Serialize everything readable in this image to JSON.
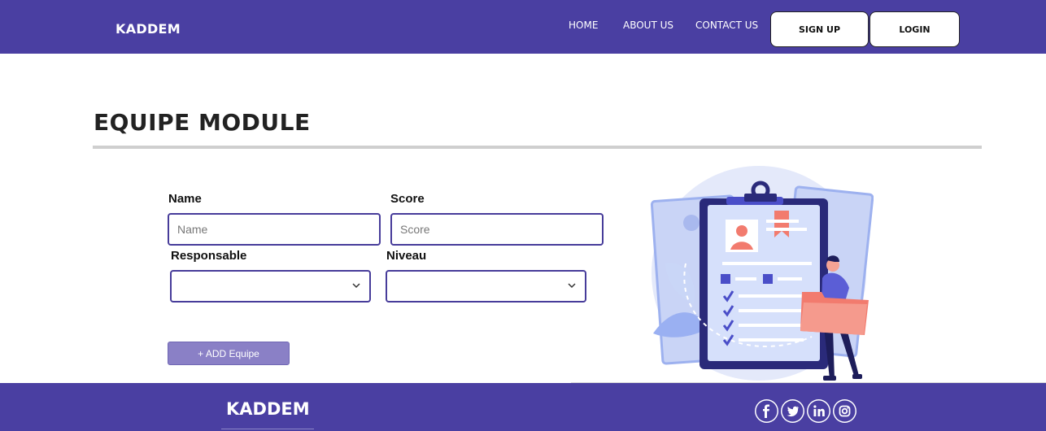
{
  "nav": {
    "brand": "KADDEM",
    "links": [
      "HOME",
      "ABOUT US",
      "CONTACT US"
    ],
    "signup_label": "SIGN UP",
    "login_label": "LOGIN"
  },
  "page": {
    "title": "EQUIPE MODULE"
  },
  "form": {
    "name_label": "Name",
    "name_placeholder": "Name",
    "score_label": "Score",
    "score_placeholder": "Score",
    "responsable_label": "Responsable",
    "responsable_value": "",
    "niveau_label": "Niveau",
    "niveau_value": "",
    "add_button_label": "+ ADD Equipe"
  },
  "footer": {
    "brand": "KADDEM",
    "social_icons": [
      "facebook-icon",
      "twitter-icon",
      "linkedin-icon",
      "instagram-icon"
    ]
  },
  "colors": {
    "primary": "#4a3fa2",
    "button_muted": "#8a80c6",
    "illustration_accent": "#f27b6e"
  }
}
